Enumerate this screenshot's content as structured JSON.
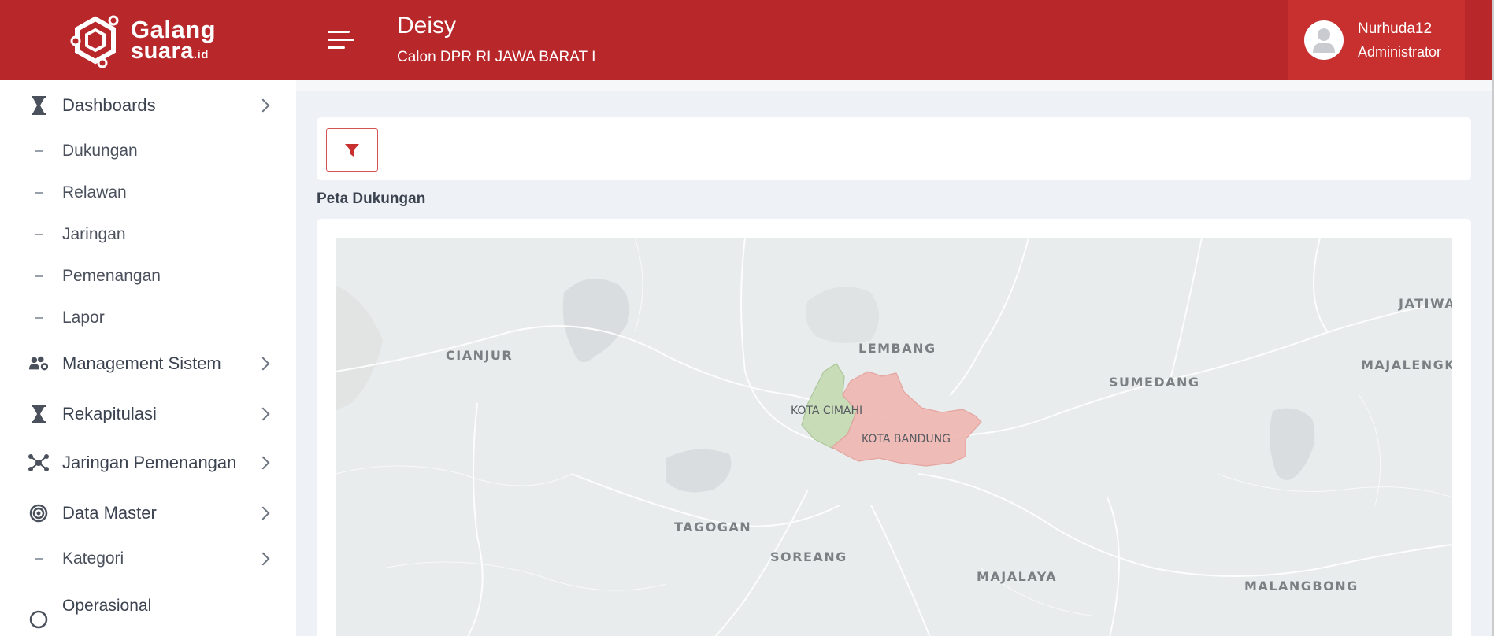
{
  "brand": {
    "line1": "Galang",
    "line2": "suara",
    "suffix": ".id"
  },
  "header": {
    "candidate_name": "Deisy",
    "candidate_subtitle": "Calon DPR RI JAWA BARAT I",
    "user_name": "Nurhuda12",
    "user_role": "Administrator",
    "color": "#b8272a"
  },
  "sidebar": {
    "dashboards": "Dashboards",
    "sub1": "Dukungan",
    "sub2": "Relawan",
    "sub3": "Jaringan",
    "sub4": "Pemenangan",
    "sub5": "Lapor",
    "management": "Management Sistem",
    "rekap": "Rekapitulasi",
    "jaringan": "Jaringan Pemenangan",
    "master": "Data Master",
    "kategori": "Kategori",
    "operasional": "Operasional"
  },
  "main": {
    "section_title": "Peta Dukungan",
    "filter_icon": "filter-icon"
  },
  "map": {
    "places": {
      "cianjur": "CIANJUR",
      "lembang": "LEMBANG",
      "sumedang": "SUMEDANG",
      "majalengka": "MAJALENGKA",
      "jatiwangi": "JATIWA",
      "tagogan": "TAGOGAN",
      "soreang": "SOREANG",
      "majalaya": "MAJALAYA",
      "malangbong": "MALANGBONG"
    },
    "regions": {
      "cimahi": "KOTA CIMAHI",
      "bandung": "KOTA BANDUNG"
    },
    "region_colors": {
      "cimahi": "#c7dcb6",
      "bandung": "#f0b9b5"
    }
  }
}
